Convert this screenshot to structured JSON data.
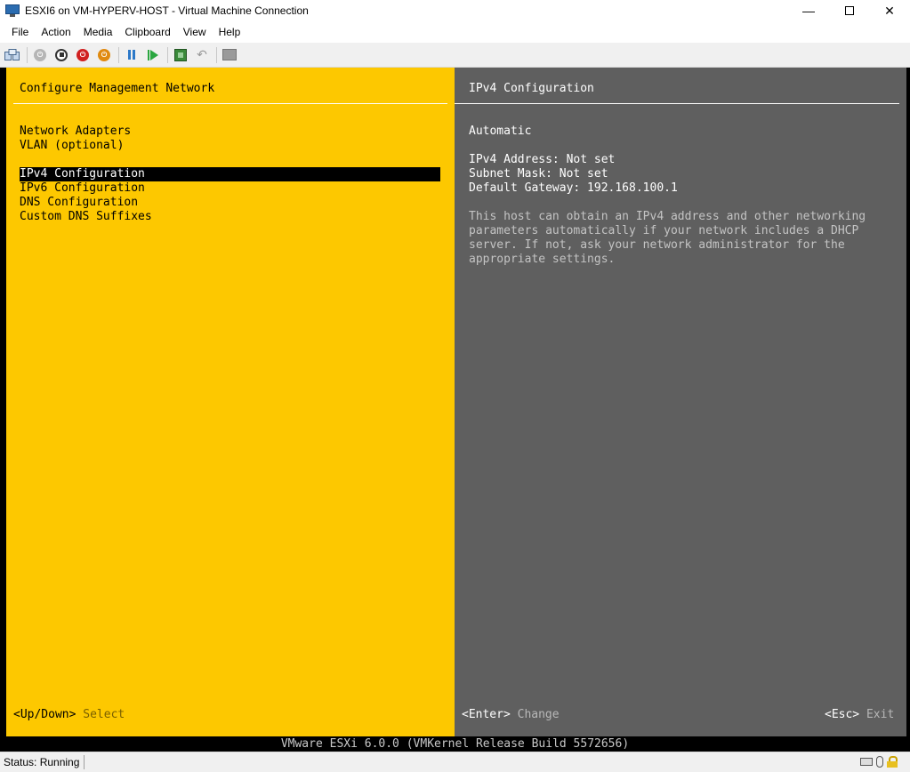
{
  "window": {
    "title": "ESXI6 on VM-HYPERV-HOST - Virtual Machine Connection",
    "controls": {
      "minimize": "—",
      "close": "✕"
    }
  },
  "menubar": [
    "File",
    "Action",
    "Media",
    "Clipboard",
    "View",
    "Help"
  ],
  "toolbar": {
    "buttons": [
      "ctrl-alt-del",
      "start",
      "turn-off",
      "shut-down",
      "save",
      "pause",
      "resume",
      "checkpoint",
      "revert",
      "enhanced-session"
    ],
    "colors": {
      "turn_off": "#d02020",
      "save": "#e08a10",
      "pause": "#2b78c8",
      "resume": "#2aa640"
    }
  },
  "console": {
    "colors": {
      "left_bg": "#fdc800",
      "right_bg": "#5f5f5f"
    },
    "left": {
      "header": "Configure Management Network",
      "items": [
        {
          "label": "Network Adapters",
          "selected": false
        },
        {
          "label": "VLAN (optional)",
          "selected": false
        },
        {
          "label": "IPv4 Configuration",
          "selected": true
        },
        {
          "label": "IPv6 Configuration",
          "selected": false
        },
        {
          "label": "DNS Configuration",
          "selected": false
        },
        {
          "label": "Custom DNS Suffixes",
          "selected": false
        }
      ],
      "footer_key": "<Up/Down>",
      "footer_action": "Select"
    },
    "right": {
      "header": "IPv4 Configuration",
      "mode": "Automatic",
      "ipv4_address": "IPv4 Address: Not set",
      "subnet_mask": "Subnet Mask: Not set",
      "default_gateway": "Default Gateway: 192.168.100.1",
      "description": [
        "This host can obtain an IPv4 address and other networking",
        "parameters automatically if your network includes a DHCP",
        "server. If not, ask your network administrator for the",
        "appropriate settings."
      ],
      "footer_enter_key": "<Enter>",
      "footer_enter_action": "Change",
      "footer_esc_key": "<Esc>",
      "footer_esc_action": "Exit"
    },
    "bottom_bar": "VMware ESXi 6.0.0 (VMKernel Release Build 5572656)"
  },
  "status": {
    "text": "Status: Running"
  }
}
